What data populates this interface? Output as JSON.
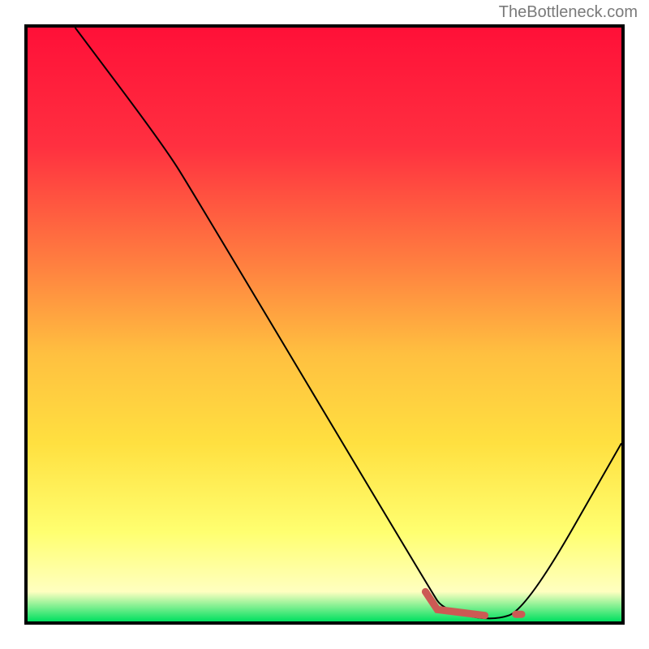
{
  "watermark": "TheBottleneck.com",
  "chart_data": {
    "type": "line",
    "title": "",
    "xlabel": "",
    "ylabel": "",
    "xlim": [
      0,
      100
    ],
    "ylim": [
      0,
      100
    ],
    "gradient_stops": [
      {
        "offset": 0,
        "color": "#ff1038"
      },
      {
        "offset": 20,
        "color": "#ff3040"
      },
      {
        "offset": 40,
        "color": "#ff8040"
      },
      {
        "offset": 55,
        "color": "#ffc040"
      },
      {
        "offset": 70,
        "color": "#ffe040"
      },
      {
        "offset": 85,
        "color": "#ffff70"
      },
      {
        "offset": 95,
        "color": "#ffffc0"
      },
      {
        "offset": 100,
        "color": "#00e060"
      }
    ],
    "series": [
      {
        "name": "bottleneck-curve",
        "stroke": "#000000",
        "stroke_width": 2,
        "points": [
          {
            "x": 8,
            "y": 100
          },
          {
            "x": 23,
            "y": 80
          },
          {
            "x": 28,
            "y": 72
          },
          {
            "x": 68,
            "y": 5
          },
          {
            "x": 70,
            "y": 2
          },
          {
            "x": 78,
            "y": 0
          },
          {
            "x": 84,
            "y": 2
          },
          {
            "x": 100,
            "y": 30
          }
        ]
      },
      {
        "name": "marker-segment",
        "stroke": "#cc5a54",
        "stroke_width": 9,
        "cap": "round",
        "points": [
          {
            "x": 67,
            "y": 5
          },
          {
            "x": 69,
            "y": 2
          },
          {
            "x": 77,
            "y": 1
          }
        ]
      },
      {
        "name": "marker-dot",
        "stroke": "#cc5a54",
        "stroke_width": 9,
        "cap": "round",
        "points": [
          {
            "x": 82.2,
            "y": 1.2
          },
          {
            "x": 83.2,
            "y": 1.2
          }
        ]
      }
    ]
  }
}
